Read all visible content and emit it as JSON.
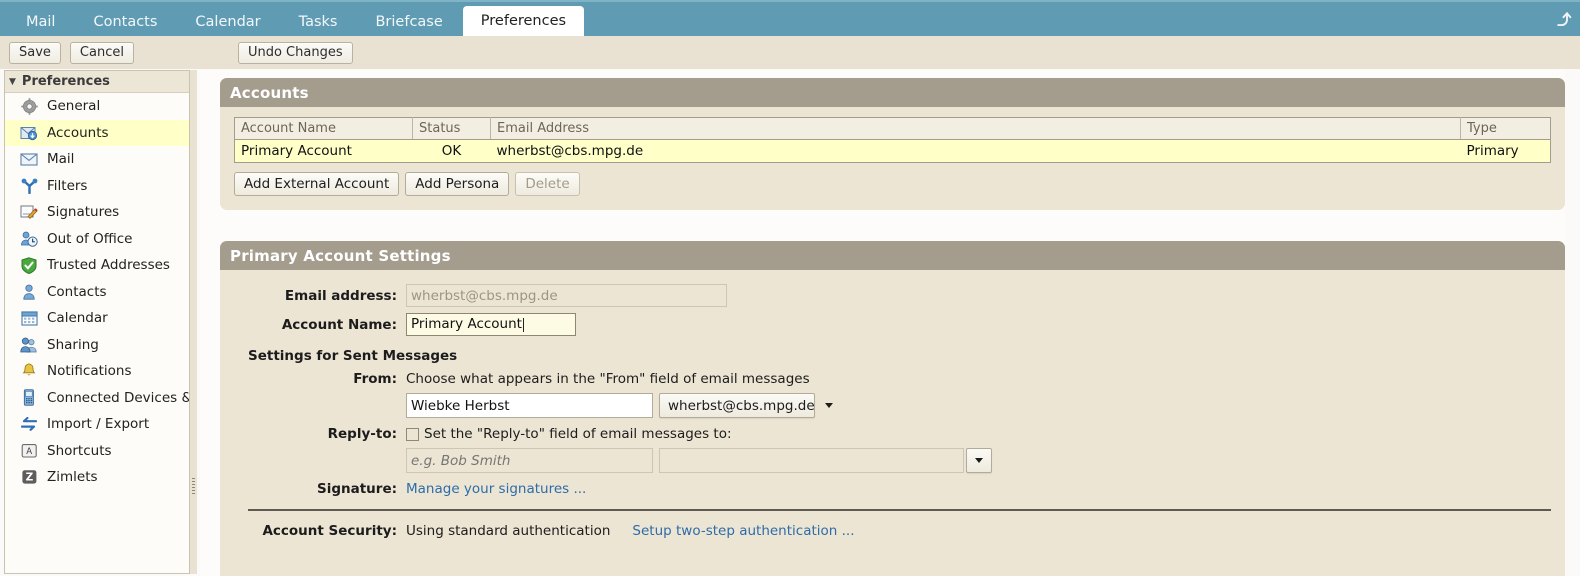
{
  "tabs": [
    {
      "label": "Mail",
      "active": false
    },
    {
      "label": "Contacts",
      "active": false
    },
    {
      "label": "Calendar",
      "active": false
    },
    {
      "label": "Tasks",
      "active": false
    },
    {
      "label": "Briefcase",
      "active": false
    },
    {
      "label": "Preferences",
      "active": true
    }
  ],
  "toolbar": {
    "save_label": "Save",
    "cancel_label": "Cancel",
    "undo_label": "Undo Changes",
    "refresh_icon": "refresh-icon"
  },
  "sidebar": {
    "header": "Preferences",
    "caret": "▼",
    "items": [
      {
        "label": "General",
        "icon": "gear-icon",
        "selected": false
      },
      {
        "label": "Accounts",
        "icon": "accounts-icon",
        "selected": true
      },
      {
        "label": "Mail",
        "icon": "envelope-icon",
        "selected": false
      },
      {
        "label": "Filters",
        "icon": "filter-fork-icon",
        "selected": false
      },
      {
        "label": "Signatures",
        "icon": "signature-pencil-icon",
        "selected": false
      },
      {
        "label": "Out of Office",
        "icon": "clock-person-icon",
        "selected": false
      },
      {
        "label": "Trusted Addresses",
        "icon": "shield-check-icon",
        "selected": false
      },
      {
        "label": "Contacts",
        "icon": "contact-person-icon",
        "selected": false
      },
      {
        "label": "Calendar",
        "icon": "calendar-icon",
        "selected": false
      },
      {
        "label": "Sharing",
        "icon": "sharing-people-icon",
        "selected": false
      },
      {
        "label": "Notifications",
        "icon": "bell-icon",
        "selected": false
      },
      {
        "label": "Connected Devices & Ap",
        "icon": "mobile-device-icon",
        "selected": false
      },
      {
        "label": "Import / Export",
        "icon": "import-export-arrows-icon",
        "selected": false
      },
      {
        "label": "Shortcuts",
        "icon": "keyboard-key-icon",
        "selected": false
      },
      {
        "label": "Zimlets",
        "icon": "zimlet-z-icon",
        "selected": false
      }
    ]
  },
  "accounts_card": {
    "title": "Accounts",
    "columns": [
      "Account Name",
      "Status",
      "Email Address",
      "Type"
    ],
    "rows": [
      {
        "name": "Primary Account",
        "status": "OK",
        "email": "wherbst@cbs.mpg.de",
        "type": "Primary",
        "selected": true
      }
    ],
    "buttons": [
      {
        "label": "Add External Account",
        "disabled": false
      },
      {
        "label": "Add Persona",
        "disabled": false
      },
      {
        "label": "Delete",
        "disabled": true
      }
    ]
  },
  "primary_card": {
    "title": "Primary Account Settings",
    "email_label": "Email address:",
    "email_value": "wherbst@cbs.mpg.de",
    "account_name_label": "Account Name:",
    "account_name_value": "Primary Account",
    "sent_section_title": "Settings for Sent Messages",
    "from_label": "From:",
    "from_description": "Choose what appears in the \"From\" field of email messages",
    "from_display_name": "Wiebke Herbst",
    "from_address_selected": "wherbst@cbs.mpg.de",
    "replyto_label": "Reply-to:",
    "replyto_checkbox_label": "Set the \"Reply-to\" field of email messages to:",
    "replyto_checked": false,
    "replyto_name_placeholder": "e.g. Bob Smith",
    "replyto_name_value": "",
    "replyto_address_value": "",
    "signature_label": "Signature:",
    "signature_link": "Manage your signatures ...",
    "account_security_label": "Account Security:",
    "account_security_value": "Using standard authentication",
    "account_security_link": "Setup two-step authentication ..."
  },
  "colors": {
    "tabbar": "#5f9cb4",
    "toolbar": "#e9e2d2",
    "card_header": "#a49c8d",
    "card_body": "#ece5d4",
    "selected_row": "#ffffc8",
    "link": "#2d6ca8"
  }
}
